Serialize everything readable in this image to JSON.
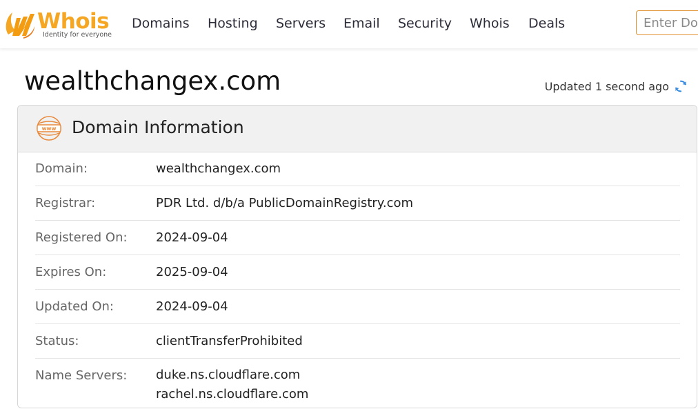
{
  "brand": {
    "name": "Whois",
    "tagline": "Identity for everyone",
    "accent_color": "#f5a623"
  },
  "nav": {
    "items": [
      "Domains",
      "Hosting",
      "Servers",
      "Email",
      "Security",
      "Whois",
      "Deals"
    ]
  },
  "search": {
    "placeholder": "Enter Domain"
  },
  "page": {
    "title": "wealthchangex.com",
    "updated_text": "Updated 1 second ago",
    "refresh_icon": "refresh-icon"
  },
  "card": {
    "title": "Domain Information",
    "icon": "www-icon",
    "rows": [
      {
        "label": "Domain:",
        "value": "wealthchangex.com"
      },
      {
        "label": "Registrar:",
        "value": "PDR Ltd. d/b/a PublicDomainRegistry.com"
      },
      {
        "label": "Registered On:",
        "value": "2024-09-04"
      },
      {
        "label": "Expires On:",
        "value": "2025-09-04"
      },
      {
        "label": "Updated On:",
        "value": "2024-09-04"
      },
      {
        "label": "Status:",
        "value": "clientTransferProhibited"
      },
      {
        "label": "Name Servers:",
        "values": [
          "duke.ns.cloudflare.com",
          "rachel.ns.cloudflare.com"
        ]
      }
    ]
  }
}
